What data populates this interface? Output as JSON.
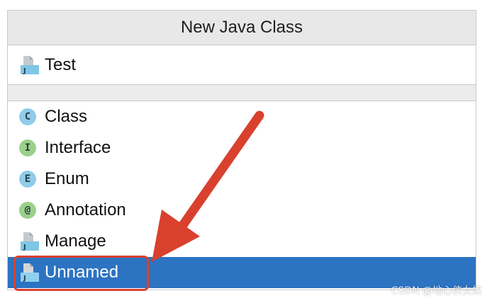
{
  "dialog": {
    "title": "New Java Class",
    "name_field": {
      "value": "Test",
      "icon": "java-file-icon"
    },
    "kinds": [
      {
        "label": "Class",
        "icon": "class-icon",
        "letter": "C",
        "icon_color": "#8fcde9",
        "selected": false
      },
      {
        "label": "Interface",
        "icon": "interface-icon",
        "letter": "I",
        "icon_color": "#9bd18a",
        "selected": false
      },
      {
        "label": "Enum",
        "icon": "enum-icon",
        "letter": "E",
        "icon_color": "#8fcde9",
        "selected": false
      },
      {
        "label": "Annotation",
        "icon": "annotation-icon",
        "letter": "@",
        "icon_color": "#9bd18a",
        "selected": false
      },
      {
        "label": "Manage",
        "icon": "java-file-icon",
        "letter": "",
        "icon_color": "",
        "selected": false
      },
      {
        "label": "Unnamed",
        "icon": "java-file-icon",
        "letter": "",
        "icon_color": "",
        "selected": true
      }
    ]
  },
  "colors": {
    "selection": "#2c73c2",
    "annotation_red": "#d9412e",
    "title_bar": "#e8e8e8"
  },
  "annotation": {
    "arrow": "red-arrow",
    "box": "red-highlight-box"
  },
  "watermark": {
    "text": "CSDN @地心侠女奴"
  }
}
